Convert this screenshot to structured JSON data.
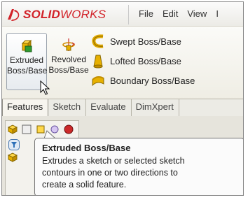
{
  "app": {
    "logo_prefix": "SOLID",
    "logo_suffix": "WORKS",
    "logo_mark": "ds-logo-icon"
  },
  "menu": [
    "File",
    "Edit",
    "View",
    "I"
  ],
  "ribbon": {
    "extruded": {
      "line1": "Extruded",
      "line2": "Boss/Base",
      "icon": "extruded-boss-icon"
    },
    "revolved": {
      "line1": "Revolved",
      "line2": "Boss/Base",
      "icon": "revolved-boss-icon"
    },
    "swept": {
      "label": "Swept Boss/Base",
      "icon": "swept-boss-icon"
    },
    "lofted": {
      "label": "Lofted Boss/Base",
      "icon": "lofted-boss-icon"
    },
    "boundary": {
      "label": "Boundary Boss/Base",
      "icon": "boundary-boss-icon"
    }
  },
  "tabs": [
    {
      "label": "Features",
      "active": true
    },
    {
      "label": "Sketch",
      "active": false
    },
    {
      "label": "Evaluate",
      "active": false
    },
    {
      "label": "DimXpert",
      "active": false
    }
  ],
  "tooltip": {
    "title": "Extruded Boss/Base",
    "lines": [
      "Extrudes a sketch or selected sketch",
      "contours in one or two directions to",
      "create a solid feature."
    ]
  },
  "colors": {
    "brand_red": "#d2232a",
    "ribbon_bg": "#efede4",
    "tab_bg": "#ecebe5"
  }
}
